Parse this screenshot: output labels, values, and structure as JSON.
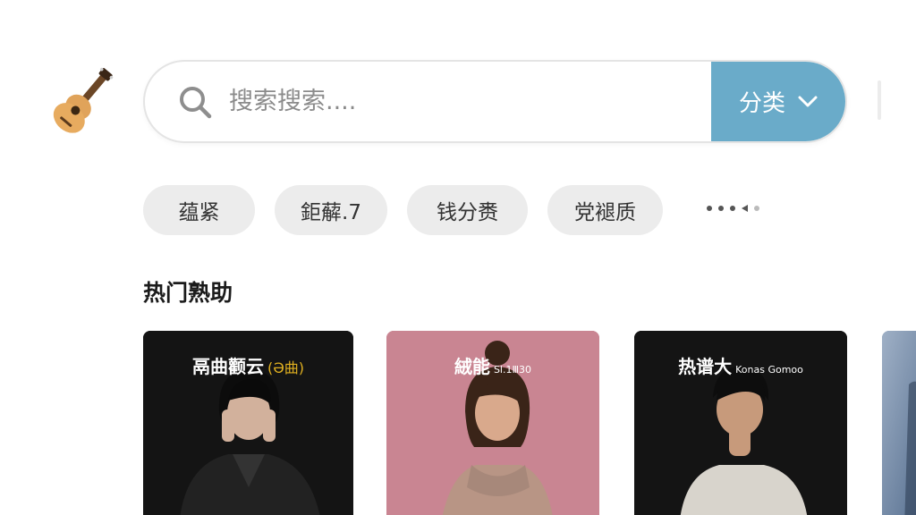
{
  "header": {
    "logo_icon": "guitar-icon",
    "search": {
      "placeholder": "搜索搜索....",
      "icon": "search-icon"
    },
    "category_button": {
      "label": "分类",
      "icon": "chevron-down-icon",
      "color": "#6aabc9"
    }
  },
  "chips": [
    {
      "label": "蕴紧"
    },
    {
      "label": "鉅薢.7"
    },
    {
      "label": "钱分赉"
    },
    {
      "label": "党褪质"
    }
  ],
  "chip_pager_icon": "pagination-dots-icon",
  "section": {
    "title": "热门熟助"
  },
  "cards": [
    {
      "title": "鬲曲颧云",
      "subtitle": "(Ə曲)",
      "background": "#141414",
      "title_color": "#ffffff",
      "subtitle_color": "#e0b020"
    },
    {
      "title": "絨能",
      "subtitle": "Sl.1Ⅲ30",
      "background": "#c98592",
      "title_color": "#ffffff",
      "subtitle_color": "#ffffff"
    },
    {
      "title": "热谱大",
      "subtitle": "Konas Gomoo",
      "background": "#141414",
      "title_color": "#ffffff",
      "subtitle_color": "#ffffff"
    },
    {
      "title": "",
      "subtitle": "",
      "background": "#6b86a8",
      "title_color": "#ffffff",
      "subtitle_color": "#ffffff"
    }
  ]
}
